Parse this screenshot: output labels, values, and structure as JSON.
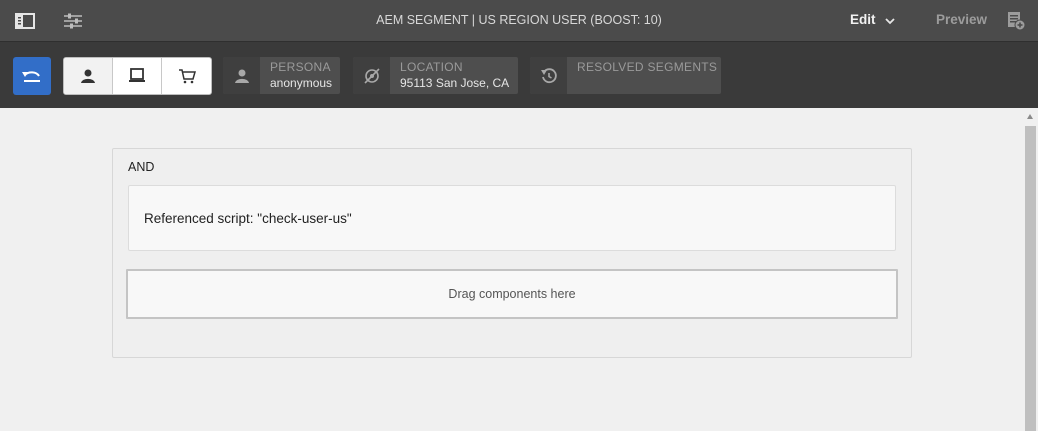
{
  "topbar": {
    "title": "AEM SEGMENT | US REGION USER (BOOST: 10)",
    "edit_label": "Edit",
    "preview_label": "Preview"
  },
  "toolbar": {
    "persona": {
      "label": "PERSONA",
      "value": "anonymous"
    },
    "location": {
      "label": "LOCATION",
      "value": "95113 San Jose, CA"
    },
    "resolved": {
      "label": "RESOLVED SEGMENTS",
      "value": ""
    }
  },
  "editor": {
    "and_label": "AND",
    "script_text": "Referenced script: \"check-user-us\"",
    "drop_zone": "Drag components here"
  },
  "colors": {
    "topbar_bg": "#4b4b4b",
    "toolbar_bg": "#3a3a3a",
    "accent": "#326ec8"
  }
}
